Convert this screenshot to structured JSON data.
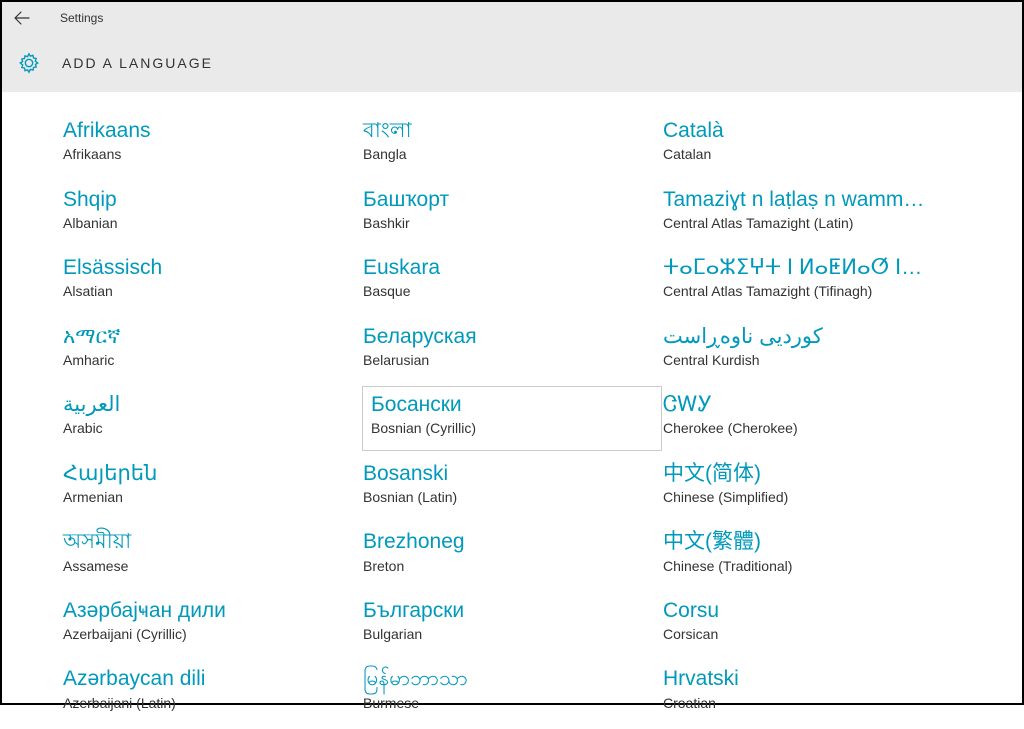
{
  "titlebar": {
    "title": "Settings"
  },
  "header": {
    "title": "ADD A LANGUAGE"
  },
  "languages": {
    "col1": [
      {
        "native": "Afrikaans",
        "english": "Afrikaans"
      },
      {
        "native": "Shqip",
        "english": "Albanian"
      },
      {
        "native": "Elsässisch",
        "english": "Alsatian"
      },
      {
        "native": "አማርኛ",
        "english": "Amharic"
      },
      {
        "native": "العربية",
        "english": "Arabic"
      },
      {
        "native": "Հայերեն",
        "english": "Armenian"
      },
      {
        "native": "অসমীয়া",
        "english": "Assamese"
      },
      {
        "native": "Азәрбајҹан дили",
        "english": "Azerbaijani (Cyrillic)"
      },
      {
        "native": "Azərbaycan dili",
        "english": "Azerbaijani (Latin)"
      }
    ],
    "col2": [
      {
        "native": "বাংলা",
        "english": "Bangla"
      },
      {
        "native": "Башҡорт",
        "english": "Bashkir"
      },
      {
        "native": "Euskara",
        "english": "Basque"
      },
      {
        "native": "Беларуская",
        "english": "Belarusian"
      },
      {
        "native": "Босански",
        "english": "Bosnian (Cyrillic)",
        "selected": true
      },
      {
        "native": "Bosanski",
        "english": "Bosnian (Latin)"
      },
      {
        "native": "Brezhoneg",
        "english": "Breton"
      },
      {
        "native": "Български",
        "english": "Bulgarian"
      },
      {
        "native": "မြန်မာဘာသာ",
        "english": "Burmese"
      }
    ],
    "col3": [
      {
        "native": "Català",
        "english": "Catalan"
      },
      {
        "native": "Tamaziɣt n laṭlaṣ n wamm…",
        "english": "Central Atlas Tamazight (Latin)"
      },
      {
        "native": "ⵜⴰⵎⴰⵣⵉⵖⵜ ⵏ ⵍⴰⵟⵍⴰⵚ ⵏ ⵡⴰⵎⵎⴰⵙ",
        "english": "Central Atlas Tamazight (Tifinagh)"
      },
      {
        "native": "کوردیی ناوەڕاست",
        "english": "Central Kurdish"
      },
      {
        "native": "ᏣᎳᎩ",
        "english": "Cherokee (Cherokee)"
      },
      {
        "native": "中文(简体)",
        "english": "Chinese (Simplified)"
      },
      {
        "native": "中文(繁體)",
        "english": "Chinese (Traditional)"
      },
      {
        "native": "Corsu",
        "english": "Corsican"
      },
      {
        "native": "Hrvatski",
        "english": "Croatian"
      }
    ]
  }
}
